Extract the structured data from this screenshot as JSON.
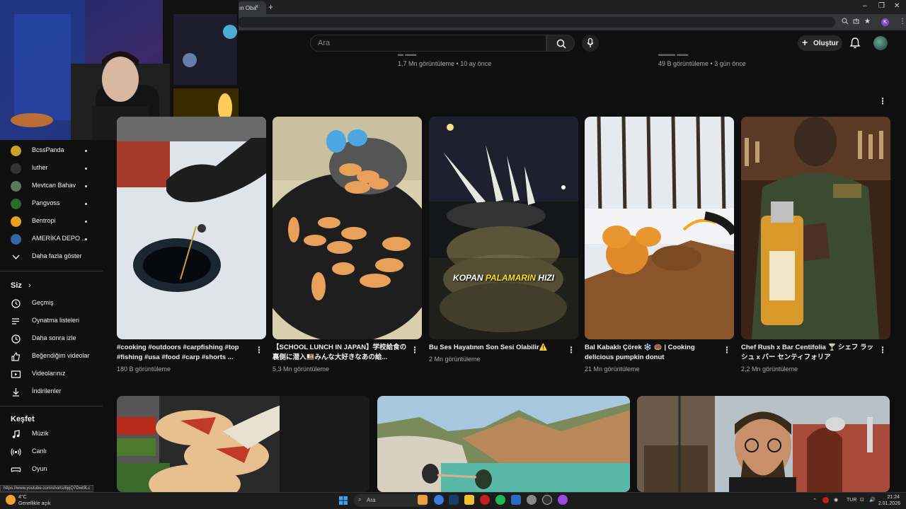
{
  "browser": {
    "tab_title": "ın Oba",
    "tab_close": "×",
    "new_tab": "+",
    "window_controls": [
      "–",
      "❐",
      "✕"
    ]
  },
  "header": {
    "search_placeholder": "Ara",
    "create_label": "Oluştur"
  },
  "top_row_meta": [
    {
      "views": "1,7 Mn görüntüleme • 10 ay önce"
    },
    {
      "views": "49 B görüntüleme • 3 gün önce"
    }
  ],
  "sidebar": {
    "subscriptions": [
      {
        "label": "BcssPanda",
        "avatar_color": "#c9a227"
      },
      {
        "label": "luther",
        "avatar_color": "#333333"
      },
      {
        "label": "Mevtcan Bahav",
        "avatar_color": "#5a7a5a"
      },
      {
        "label": "Pangvoss",
        "avatar_color": "#2a6a2a"
      },
      {
        "label": "Bentropi",
        "avatar_color": "#e5a020"
      },
      {
        "label": "AMERİKA DEPO ...",
        "avatar_color": "#3366aa"
      }
    ],
    "show_more": "Daha fazla göster",
    "you_heading": "Siz",
    "you_items": [
      {
        "label": "Geçmiş",
        "icon": "history-icon"
      },
      {
        "label": "Oynatma listeleri",
        "icon": "playlist-icon"
      },
      {
        "label": "Daha sonra izle",
        "icon": "clock-icon"
      },
      {
        "label": "Beğendiğim videolar",
        "icon": "thumbs-up-icon"
      },
      {
        "label": "Videolarınız",
        "icon": "video-icon"
      },
      {
        "label": "İndirilenler",
        "icon": "download-icon"
      }
    ],
    "explore_heading": "Keşfet",
    "explore_items": [
      {
        "label": "Müzik",
        "icon": "music-icon"
      },
      {
        "label": "Canlı",
        "icon": "live-icon"
      },
      {
        "label": "Oyun",
        "icon": "gaming-icon"
      }
    ]
  },
  "shorts": [
    {
      "title": "#cooking #outdoors #carpfishing #top #fishing #usa #food #carp #shorts ...",
      "views": "180 B görüntüleme"
    },
    {
      "title": "【SCHOOL LUNCH IN JAPAN】学校給食の裏側に潜入🍱みんな大好きなあの給...",
      "views": "5,3 Mn görüntüleme"
    },
    {
      "title": "Bu Ses Hayatının Son Sesi Olabilir⚠️",
      "views": "2 Mn görüntüleme",
      "overlay_a": "KOPAN ",
      "overlay_b": "PALAMARIN",
      "overlay_c": " HIZI"
    },
    {
      "title": "Bal Kabaklı Çörek ❄️ 🍩 | Cooking delicious pumpkin donut",
      "views": "21 Mn görüntüleme"
    },
    {
      "title": "Chef Rush x Bar Centifolia 🍸 シェフ ラッシュ x バー センティフォリア",
      "views": "2,2 Mn görüntüleme"
    }
  ],
  "status_url": "https://www.youtube.com/shorts/6jqQ7Dwt9Lc",
  "taskbar": {
    "weather_temp": "4°C",
    "weather_desc": "Genellikle açık",
    "search_label": "Ara",
    "lang": "TUR",
    "time": "21:24",
    "date": "2.01.2026"
  },
  "colors": {
    "background": "#0f0f0f",
    "text": "#f1f1f1",
    "meta": "#aaaaaa"
  }
}
